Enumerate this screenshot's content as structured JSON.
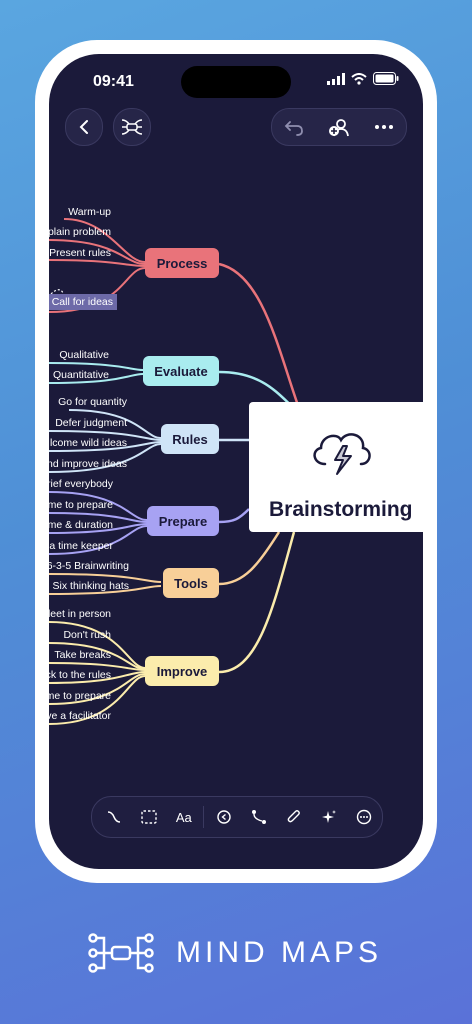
{
  "status_bar": {
    "time": "09:41"
  },
  "central_topic": "Brainstorming",
  "branches": [
    {
      "label": "Process",
      "color": "#e9737a",
      "children": [
        "Warm-up",
        "plain problem",
        "Present rules",
        "Call for ideas"
      ]
    },
    {
      "label": "Evaluate",
      "color": "#a9ecef",
      "children": [
        "Qualitative",
        "Quantitative"
      ]
    },
    {
      "label": "Rules",
      "color": "#cfe4f7",
      "children": [
        "Go for quantity",
        "Defer judgment",
        "lcome wild ideas",
        "nd improve ideas"
      ]
    },
    {
      "label": "Prepare",
      "color": "#a7a2f3",
      "children": [
        "rief everybody",
        "me to prepare",
        "me & duration",
        "a time keeper"
      ]
    },
    {
      "label": "Tools",
      "color": "#f8cf98",
      "children": [
        "6-3-5 Brainwriting",
        "Six thinking hats"
      ]
    },
    {
      "label": "Improve",
      "color": "#fbecac",
      "children": [
        "leet in person",
        "Don't rush",
        "Take breaks",
        "ck to the rules",
        "me to prepare",
        "ve a facilitator"
      ]
    }
  ],
  "toolbar": {
    "text_tool_label": "Aa"
  },
  "footer": {
    "label": "MIND MAPS"
  }
}
